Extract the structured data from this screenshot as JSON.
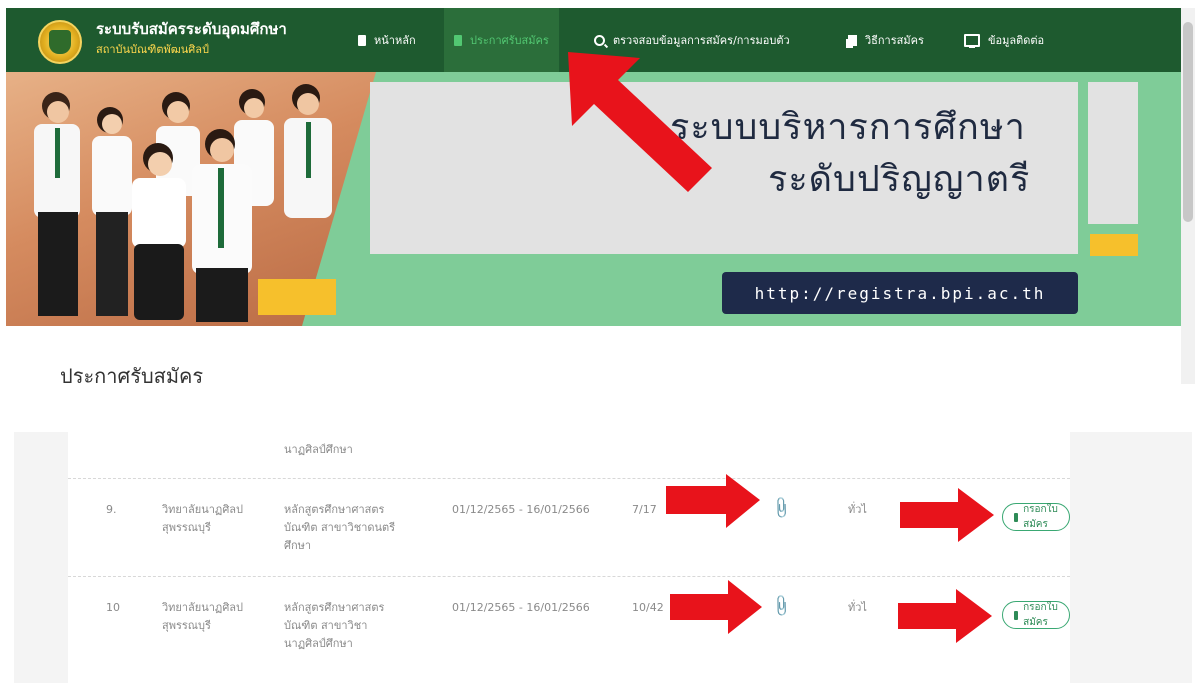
{
  "header": {
    "brand_title": "ระบบรับสมัครระดับอุดมศึกษา",
    "brand_subtitle": "สถาบันบัณฑิตพัฒนศิลป์",
    "menu": [
      {
        "label": "หน้าหลัก",
        "icon": "document-icon"
      },
      {
        "label": "ประกาศรับสมัคร",
        "icon": "document-icon",
        "active": true
      },
      {
        "label": "ตรวจสอบข้อมูลการสมัคร/การมอบตัว",
        "icon": "search-icon"
      },
      {
        "label": "วิธีการสมัคร",
        "icon": "copy-icon"
      },
      {
        "label": "ข้อมูลติดต่อ",
        "icon": "monitor-icon"
      }
    ]
  },
  "banner": {
    "line1": "ระบบบริหารการศึกษา",
    "line2": "ระดับปริญญาตรี",
    "url": "http://registra.bpi.ac.th"
  },
  "page_title": "ประกาศรับสมัคร",
  "table": {
    "partial_row_text": "นาฏศิลป์ศึกษา",
    "rows": [
      {
        "no": "9.",
        "college_line1": "วิทยาลัยนาฏศิลป",
        "college_line2": "สุพรรณบุรี",
        "program_line1": "หลักสูตรศึกษาศาสตร",
        "program_line2": "บัณฑิต สาขาวิชาดนตรี",
        "program_line3": "ศึกษา",
        "dates": "01/12/2565 - 16/01/2566",
        "count": "7/17",
        "type": "ทั่วไ",
        "apply_label": "กรอกใบสมัคร"
      },
      {
        "no": "10",
        "college_line1": "วิทยาลัยนาฏศิลป",
        "college_line2": "สุพรรณบุรี",
        "program_line1": "หลักสูตรศึกษาศาสตร",
        "program_line2": "บัณฑิต สาขาวิชา",
        "program_line3": "นาฏศิลป์ศึกษา",
        "dates": "01/12/2565 - 16/01/2566",
        "count": "10/42",
        "type": "ทั่วไ",
        "apply_label": "กรอกใบสมัคร"
      }
    ]
  },
  "colors": {
    "navbar": "#1e5a2f",
    "banner_green": "#7fcc98",
    "accent_yellow": "#f6c02c",
    "url_box": "#1e2a4a",
    "arrow_red": "#e8131b",
    "button_green": "#2e8b57"
  }
}
